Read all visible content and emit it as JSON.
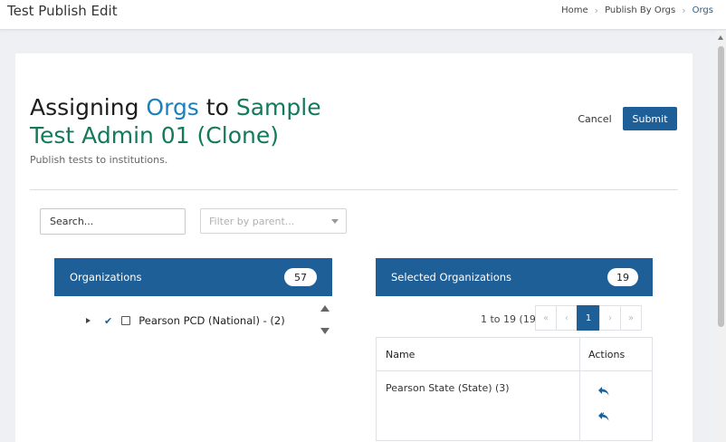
{
  "header": {
    "title": "Test Publish Edit",
    "breadcrumb": [
      "Home",
      "Publish By Orgs",
      "Orgs"
    ]
  },
  "page": {
    "title_prefix": "Assigning ",
    "title_entity": "Orgs",
    "title_mid": " to ",
    "title_test": "Sample Test Admin 01 (Clone)",
    "subtitle": "Publish tests to institutions.",
    "cancel_label": "Cancel",
    "submit_label": "Submit"
  },
  "filters": {
    "search_placeholder": "Search...",
    "parent_placeholder": "Filter by parent..."
  },
  "organizations": {
    "header": "Organizations",
    "count": "57",
    "items": [
      {
        "label": "Pearson PCD (National) - (2)",
        "checked": false
      }
    ]
  },
  "selected": {
    "header": "Selected Organizations",
    "count": "19",
    "range": "1 to 19 (19)",
    "pagination": {
      "first": "«",
      "prev": "‹",
      "page": "1",
      "next": "›",
      "last": "»"
    },
    "columns": [
      "Name",
      "Actions"
    ],
    "rows": [
      {
        "name": "Pearson State (State) (3)"
      }
    ]
  },
  "colors": {
    "primary": "#1f5f97",
    "accent_blue": "#1a80bb",
    "accent_green": "#127a5a"
  }
}
